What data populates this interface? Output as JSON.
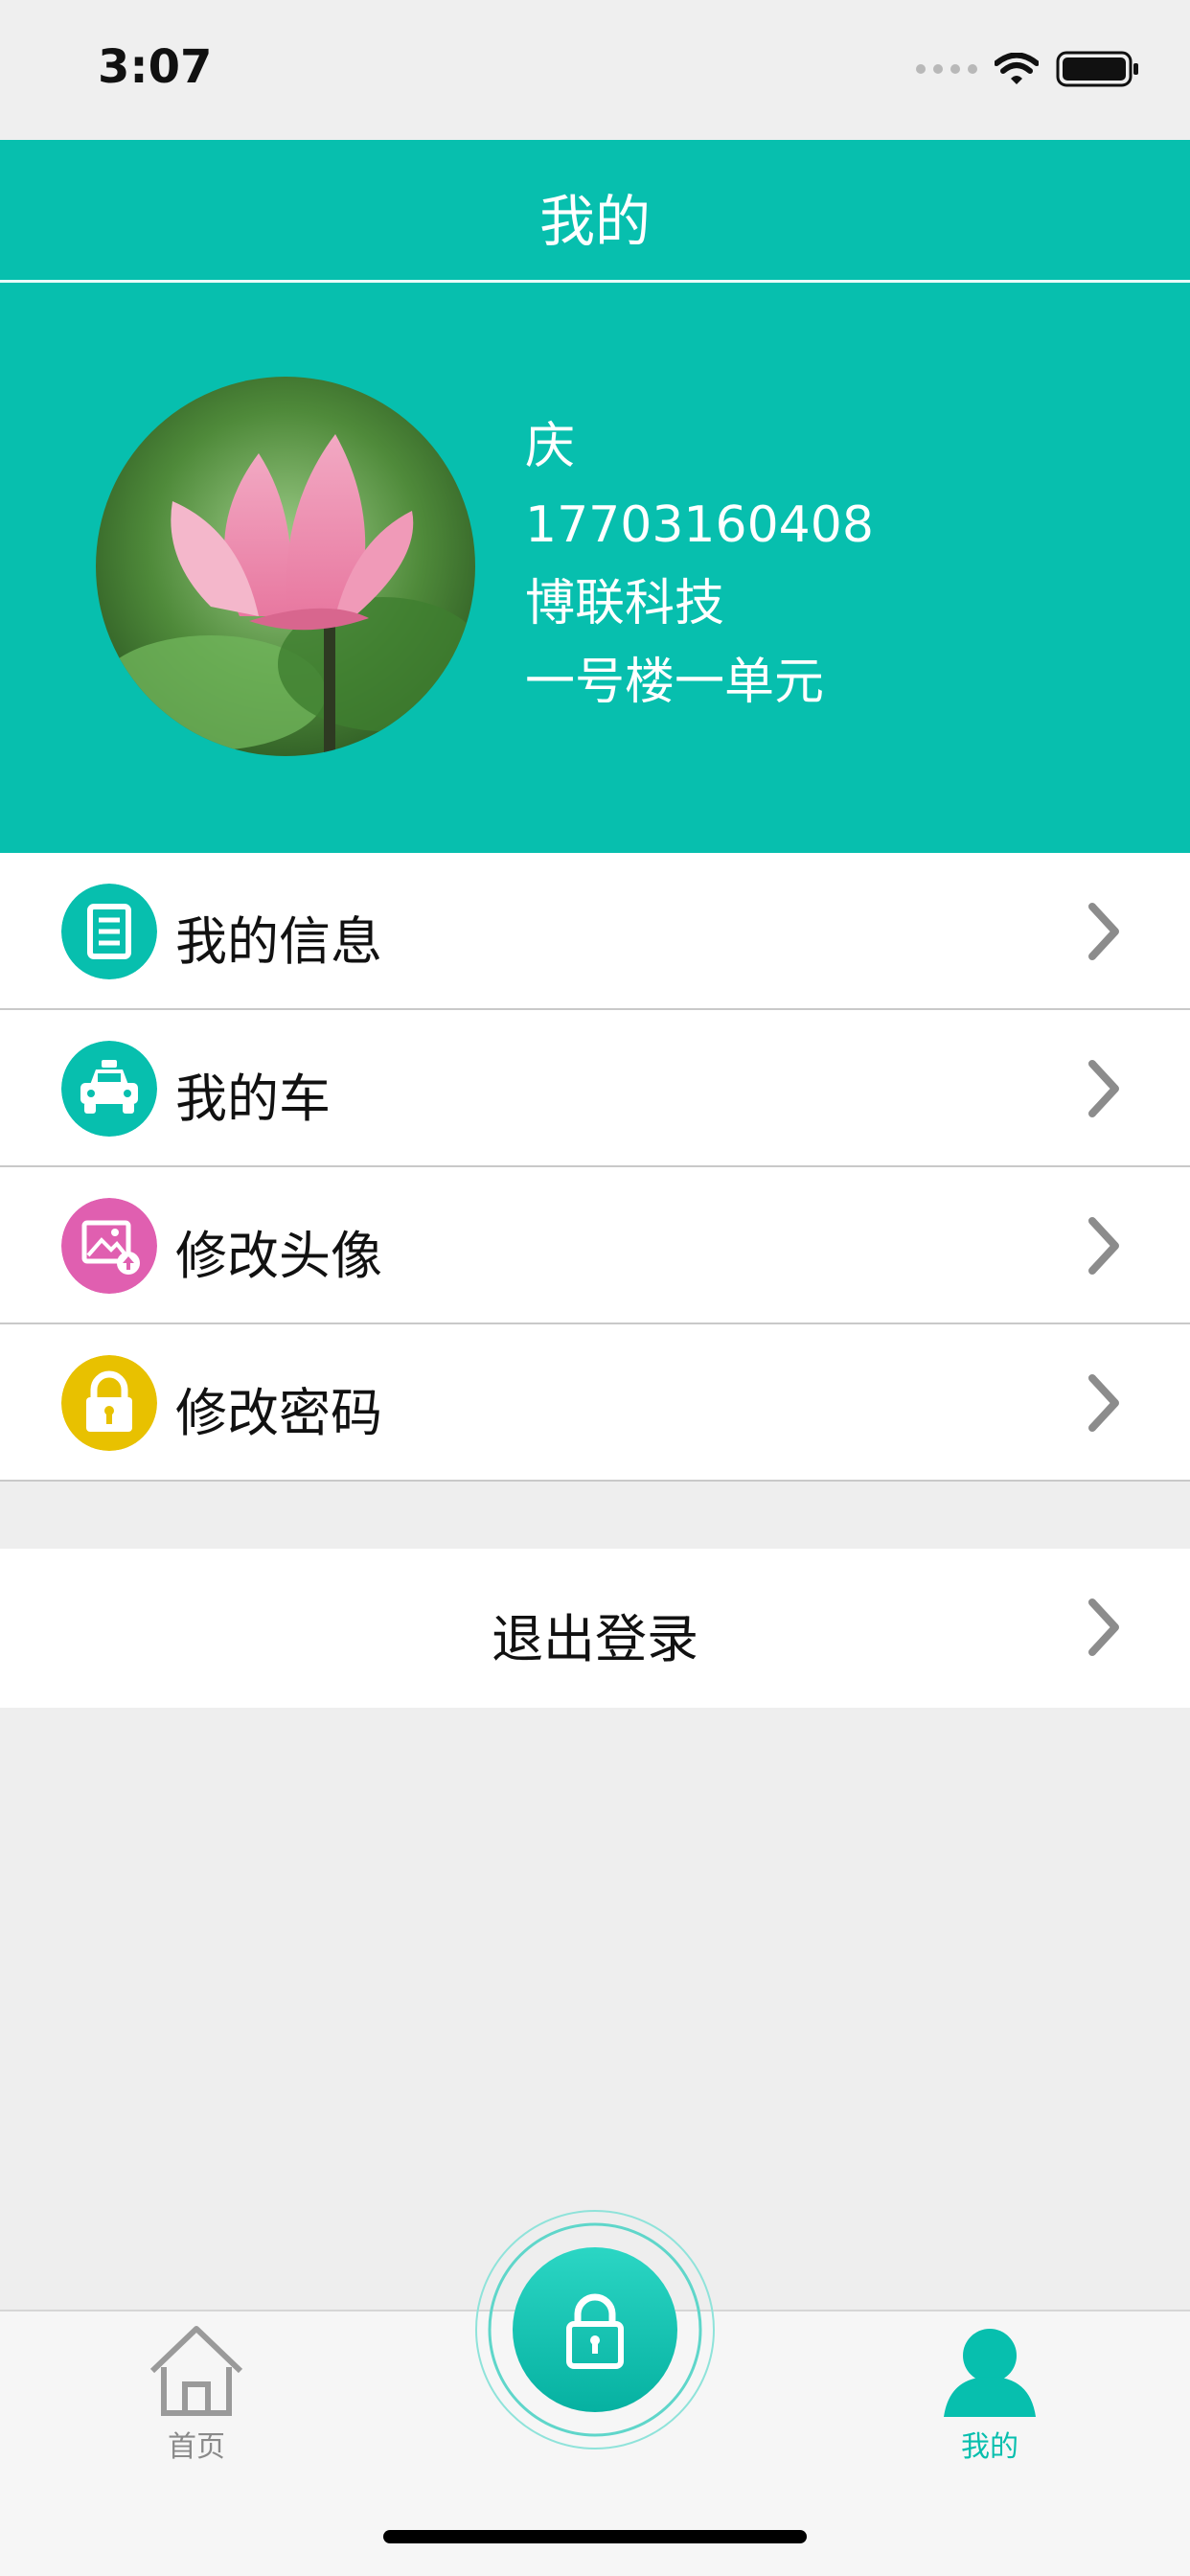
{
  "status_bar": {
    "time": "3:07"
  },
  "header": {
    "title": "我的"
  },
  "profile": {
    "name": "庆",
    "phone": "17703160408",
    "company": "博联科技",
    "address": "一号楼一单元"
  },
  "menu": [
    {
      "label": "我的信息",
      "icon": "document-icon",
      "color": "#07bfae"
    },
    {
      "label": "我的车",
      "icon": "car-icon",
      "color": "#07bfae"
    },
    {
      "label": "修改头像",
      "icon": "image-upload-icon",
      "color": "#e05fb0"
    },
    {
      "label": "修改密码",
      "icon": "lock-icon",
      "color": "#e8c100"
    }
  ],
  "logout": {
    "label": "退出登录"
  },
  "tabbar": {
    "home_label": "首页",
    "mine_label": "我的",
    "active_color": "#07bfae",
    "inactive_color": "#8a8a8a"
  }
}
